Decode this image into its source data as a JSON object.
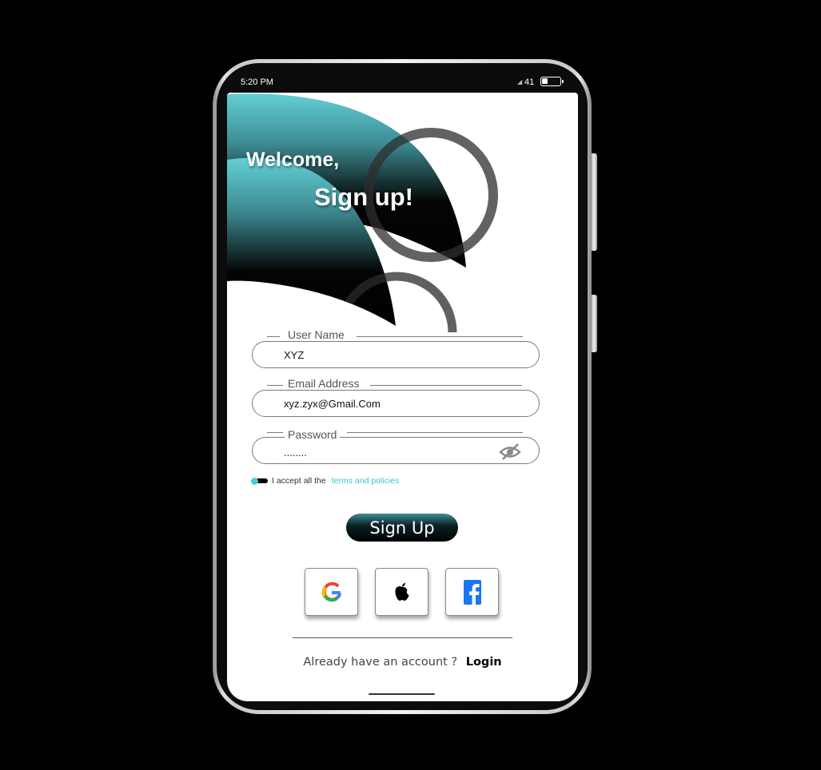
{
  "status_bar": {
    "time": "5:20 PM",
    "battery_level": "41"
  },
  "header": {
    "welcome": "Welcome,",
    "title": "Sign up!"
  },
  "form": {
    "username": {
      "label": "User Name",
      "value": "XYZ"
    },
    "email": {
      "label": "Email Address",
      "value": "xyz.zyx@Gmail.Com"
    },
    "password": {
      "label": "Password",
      "value": "........"
    },
    "terms": {
      "prefix": "I accept all the",
      "link": "terms and policies"
    },
    "submit_label": "Sign Up"
  },
  "social": [
    {
      "name": "google-icon"
    },
    {
      "name": "apple-icon"
    },
    {
      "name": "facebook-icon"
    }
  ],
  "footer": {
    "prompt": "Already have an account ?",
    "login_label": "Login"
  },
  "colors": {
    "accent": "#43d1d8",
    "background": "#000000",
    "facebook": "#1877f2"
  }
}
